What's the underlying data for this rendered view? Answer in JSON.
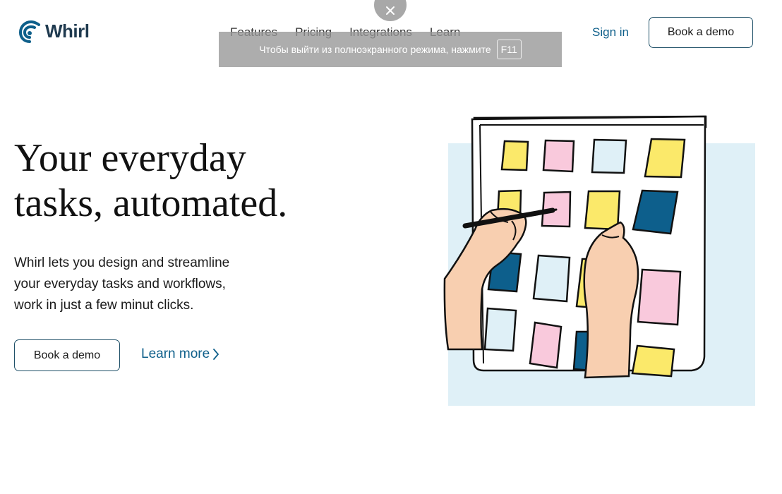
{
  "brand": {
    "name": "Whirl",
    "logo_icon": "whirl-swirl-logo",
    "color": "#0e5f8a"
  },
  "nav": {
    "items": [
      "Features",
      "Pricing",
      "Integrations",
      "Learn"
    ]
  },
  "header": {
    "signin_label": "Sign in",
    "demo_label": "Book a demo"
  },
  "fullscreen_notice": {
    "text": "Чтобы выйти из полноэкранного режима, нажмите",
    "key": "F11",
    "close_icon": "close-icon"
  },
  "hero": {
    "title_line1": "Your everyday",
    "title_line2": "tasks, automated.",
    "description_line1": "Whirl lets you design and streamline",
    "description_line2": "your everyday tasks and workflows,",
    "description_line3": "work in just a few minut clicks.",
    "demo_label": "Book a demo",
    "learn_more_label": "Learn more",
    "learn_more_icon": "chevron-right-icon"
  },
  "illustration": {
    "name": "sticky-note-board-illustration",
    "colors": {
      "yellow": "#fbe96a",
      "pink": "#f9c9dc",
      "light_blue": "#dff0f7",
      "dark_blue": "#0d5f8c",
      "skin": "#f8cfb0",
      "backdrop": "#dff0f7"
    }
  }
}
